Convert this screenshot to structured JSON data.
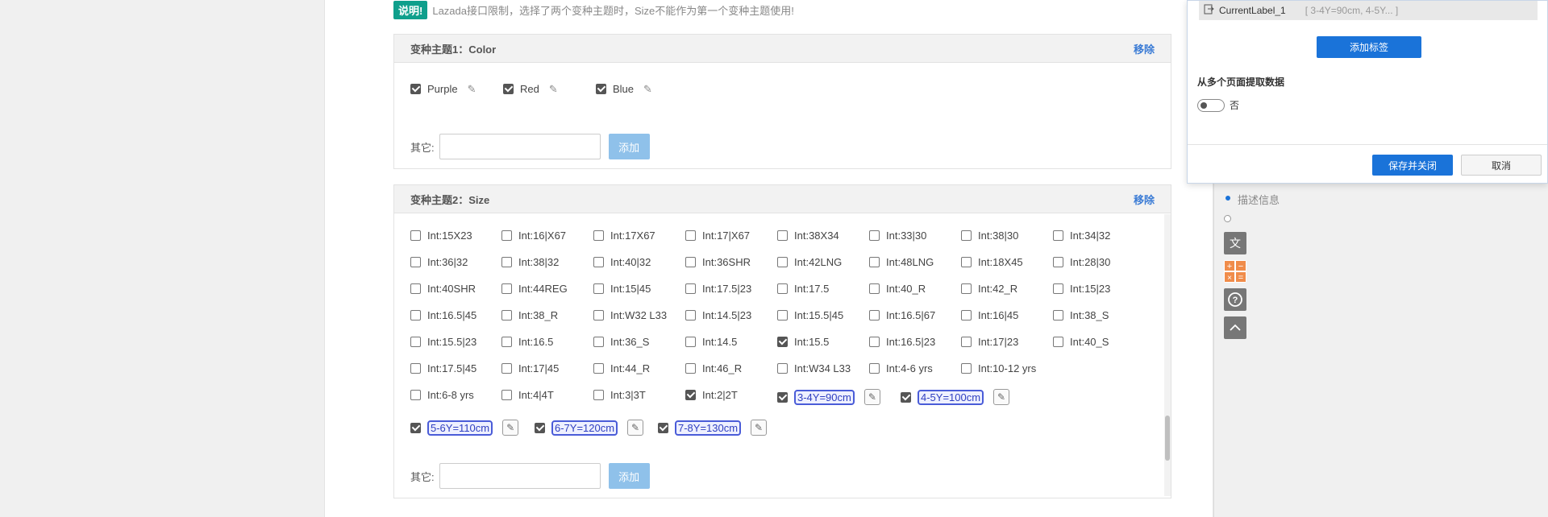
{
  "notice": {
    "badge": "说明!",
    "text": "Lazada接口限制，选择了两个变种主题时，Size不能作为第一个变种主题使用!"
  },
  "theme1": {
    "title": "变种主题1：",
    "name": "Color",
    "remove": "移除",
    "options": [
      {
        "label": "Purple",
        "checked": true
      },
      {
        "label": "Red",
        "checked": true
      },
      {
        "label": "Blue",
        "checked": true
      }
    ],
    "other_label": "其它:",
    "add_label": "添加"
  },
  "theme2": {
    "title": "变种主题2：",
    "name": "Size",
    "remove": "移除",
    "rows": [
      [
        "Int:15X23",
        "Int:16|X67",
        "Int:17X67",
        "Int:17|X67",
        "Int:38X34",
        "Int:33|30",
        "Int:38|30",
        "Int:34|32"
      ],
      [
        "Int:36|32",
        "Int:38|32",
        "Int:40|32",
        "Int:36SHR",
        "Int:42LNG",
        "Int:48LNG",
        "Int:18X45",
        "Int:28|30"
      ],
      [
        "Int:40SHR",
        "Int:44REG",
        "Int:15|45",
        "Int:17.5|23",
        "Int:17.5",
        "Int:40_R",
        "Int:42_R",
        "Int:15|23"
      ],
      [
        "Int:16.5|45",
        "Int:38_R",
        "Int:W32 L33",
        "Int:14.5|23",
        "Int:15.5|45",
        "Int:16.5|67",
        "Int:16|45",
        "Int:38_S"
      ],
      [
        "Int:15.5|23",
        "Int:16.5",
        "Int:36_S",
        "Int:14.5",
        "Int:15.5",
        "Int:16.5|23",
        "Int:17|23",
        "Int:40_S"
      ],
      [
        "Int:17.5|45",
        "Int:17|45",
        "Int:44_R",
        "Int:46_R",
        "Int:W34 L33",
        "Int:4-6 yrs",
        "Int:10-12 yrs"
      ],
      [
        "Int:6-8 yrs",
        "Int:4|4T",
        "Int:3|3T",
        "Int:2|2T",
        "3-4Y=90cm",
        "4-5Y=100cm"
      ],
      [
        "5-6Y=110cm",
        "6-7Y=120cm",
        "7-8Y=130cm"
      ]
    ],
    "checked": [
      "Int:15.5",
      "Int:2|2T",
      "3-4Y=90cm",
      "4-5Y=100cm",
      "5-6Y=110cm",
      "6-7Y=120cm",
      "7-8Y=130cm"
    ],
    "editable": [
      "3-4Y=90cm",
      "4-5Y=100cm",
      "5-6Y=110cm",
      "6-7Y=120cm",
      "7-8Y=130cm"
    ],
    "other_label": "其它:",
    "add_label": "添加"
  },
  "dialog": {
    "label_name": "CurrentLabel_1",
    "label_value": "[ 3-4Y=90cm, 4-5Y...  ]",
    "add_tag": "添加标签",
    "multi_page_title": "从多个页面提取数据",
    "toggle_text": "否",
    "save_close": "保存并关闭",
    "cancel": "取消"
  },
  "side": {
    "step_label": "描述信息"
  },
  "colors": {
    "accent": "#1a73d9",
    "badge": "#0f9f8c",
    "add_disabled": "#8fc1ea",
    "edit_border": "#4a5cd8"
  }
}
